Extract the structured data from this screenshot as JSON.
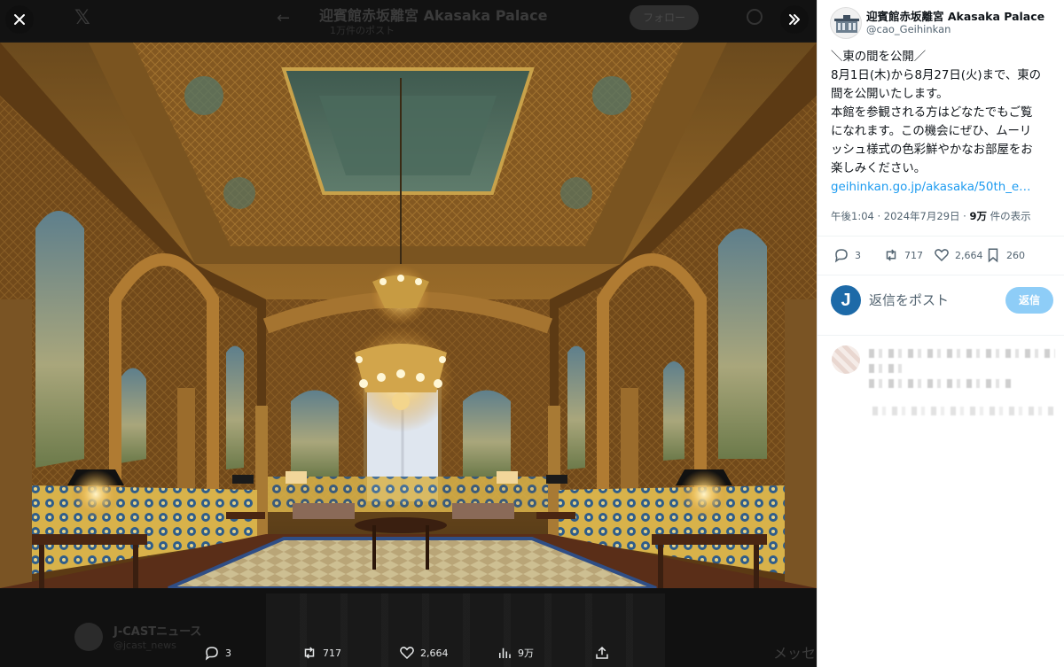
{
  "viewer": {
    "background_header": {
      "title": "迎賓館赤坂離宮 Akasaka Palace",
      "subtitle": "1万件のポスト",
      "follow_label": "フォロー"
    },
    "background_footer": {
      "account_name": "J-CASTニュース",
      "handle": "@jcast_news",
      "message_label": "メッセ"
    },
    "photo_alt": "東の間 (Eastern Hall) interior",
    "actions": {
      "reply_count": "3",
      "repost_count": "717",
      "like_count": "2,664",
      "views_count": "9万"
    }
  },
  "panel": {
    "account": {
      "name": "迎賓館赤坂離宮 Akasaka Palace",
      "handle": "@cao_Geihinkan"
    },
    "post_lines": [
      "＼東の間を公開／",
      "8月1日(木)から8月27日(火)まで、東の",
      "間を公開いたします。",
      "本館を参観される方はどなたでもご覧",
      "になれます。この機会にぜひ、ムーリ",
      "ッシュ様式の色彩鮮やかなお部屋をお",
      "楽しみください。"
    ],
    "link": "geihinkan.go.jp/akasaka/50th_e…",
    "meta": {
      "time": "午後1:04 · 2024年7月29日 · ",
      "views_bold": "9万",
      "views_suffix": " 件の表示"
    },
    "stats": {
      "replies": "3",
      "reposts": "717",
      "likes": "2,664",
      "bookmarks": "260"
    },
    "reply": {
      "avatar_letter": "J",
      "placeholder": "返信をポスト",
      "button_label": "返信"
    }
  },
  "colors": {
    "accent": "#1d9bf0",
    "reply_button": "#8ecdf7",
    "viewer_bg": "#151515"
  }
}
